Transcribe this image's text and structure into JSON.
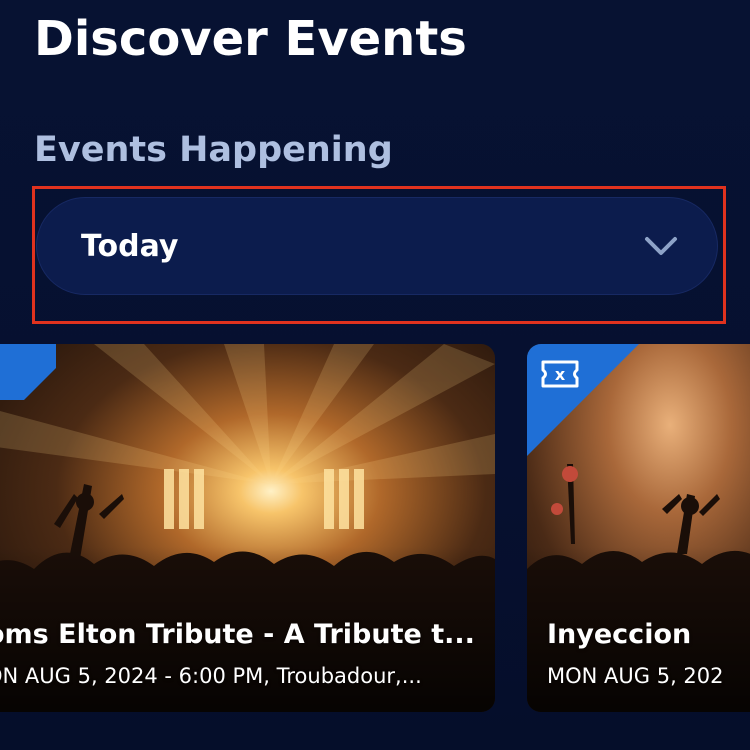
{
  "header": {
    "title": "Discover Events"
  },
  "filter": {
    "label": "Events Happening",
    "selected": "Today"
  },
  "colors": {
    "background": "#071232",
    "dropdown_bg": "#0c1c4d",
    "label_text": "#aebfe0",
    "accent_badge": "#1f6fd6",
    "highlight_border": "#e0321e"
  },
  "events": [
    {
      "title": "oms Elton Tribute - A Tribute t...",
      "datetime": "ON AUG 5, 2024 - 6:00 PM, Troubadour,...",
      "badge_icon": "ticket-icon"
    },
    {
      "title": "Inyeccion",
      "datetime": "MON AUG 5, 202",
      "badge_icon": "ticket-icon"
    }
  ]
}
